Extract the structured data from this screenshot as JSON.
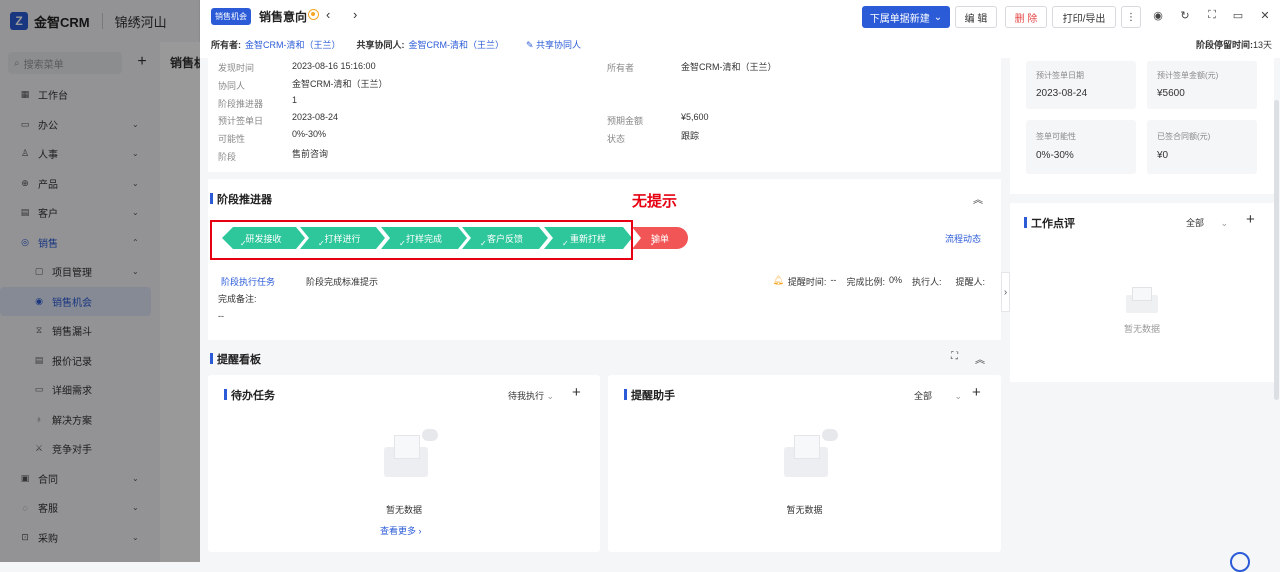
{
  "app": {
    "brand": "金智CRM",
    "org": "锦绣河山",
    "logo_letter": "Z"
  },
  "sidebar": {
    "search_placeholder": "搜索菜单",
    "items": [
      {
        "label": "工作台",
        "icon": "grid-icon"
      },
      {
        "label": "办公",
        "icon": "briefcase-icon",
        "chevron": "down"
      },
      {
        "label": "人事",
        "icon": "people-icon",
        "chevron": "down"
      },
      {
        "label": "产品",
        "icon": "box-icon",
        "chevron": "down"
      },
      {
        "label": "客户",
        "icon": "customer-icon",
        "chevron": "down"
      },
      {
        "label": "销售",
        "icon": "sales-icon",
        "chevron": "up"
      }
    ],
    "sub_items": [
      {
        "label": "项目管理",
        "icon": "project-icon",
        "chevron": "down"
      },
      {
        "label": "销售机会",
        "icon": "opportunity-icon"
      },
      {
        "label": "销售漏斗",
        "icon": "funnel-icon"
      },
      {
        "label": "报价记录",
        "icon": "quote-icon"
      },
      {
        "label": "详细需求",
        "icon": "requirement-icon"
      },
      {
        "label": "解决方案",
        "icon": "solution-icon"
      },
      {
        "label": "竞争对手",
        "icon": "competitor-icon"
      }
    ],
    "items_after": [
      {
        "label": "合同",
        "icon": "contract-icon",
        "chevron": "down"
      },
      {
        "label": "客服",
        "icon": "service-icon",
        "chevron": "down"
      },
      {
        "label": "采购",
        "icon": "purchase-icon",
        "chevron": "down"
      }
    ]
  },
  "background_page": {
    "title": "销售机"
  },
  "drawer": {
    "tag": "销售机会",
    "title": "销售意向",
    "buttons": {
      "new_sub": "下属单据新建",
      "edit": "编 辑",
      "delete": "删 除",
      "print": "打印/导出"
    },
    "owner_label": "所有者:",
    "owner_value": "金智CRM-清和（王兰）",
    "collab_label": "共享协同人:",
    "collab_value": "金智CRM-清和（王兰）",
    "share_link": "共享协同人",
    "stay_label": "阶段停留时间:",
    "stay_value": "13天"
  },
  "info": {
    "rows_left": [
      {
        "label": "发现时间",
        "value": "2023-08-16 15:16:00"
      },
      {
        "label": "协同人",
        "value": "金智CRM-清和（王兰）"
      },
      {
        "label": "阶段推进器",
        "value": "1"
      },
      {
        "label": "预计签单日",
        "value": "2023-08-24"
      },
      {
        "label": "可能性",
        "value": "0%-30%"
      },
      {
        "label": "阶段",
        "value": "售前咨询"
      }
    ],
    "rows_right": [
      {
        "label": "所有者",
        "value": "金智CRM-清和（王兰）"
      },
      {
        "label": "预期金额",
        "value": "¥5,600"
      },
      {
        "label": "状态",
        "value": "跟踪"
      }
    ]
  },
  "stage_advancer": {
    "title": "阶段推进器",
    "stages": [
      "研发接收",
      "打样进行",
      "打样完成",
      "客户反馈",
      "重新打样"
    ],
    "lost_stage": "输单",
    "flow_link": "流程动态",
    "annotation": "无提示",
    "task_tab": "阶段执行任务",
    "standard_tip": "阶段完成标准提示",
    "remind_time_label": "提醒时间:",
    "remind_time_value": "--",
    "ratio_label": "完成比例:",
    "ratio_value": "0%",
    "executor_label": "执行人:",
    "reminder_label": "提醒人:",
    "remark_label": "完成备注:",
    "remark_value": "--"
  },
  "reminder_board": {
    "title": "提醒看板",
    "todo": {
      "title": "待办任务",
      "filter": "待我执行",
      "empty": "暂无数据",
      "more": "查看更多"
    },
    "assistant": {
      "title": "提醒助手",
      "filter": "全部",
      "empty": "暂无数据"
    }
  },
  "right_panel": {
    "stats": [
      {
        "label": "预计签单日期",
        "value": "2023-08-24"
      },
      {
        "label": "预计签单金额(元)",
        "value": "¥5600"
      },
      {
        "label": "签单可能性",
        "value": "0%-30%"
      },
      {
        "label": "已签合同额(元)",
        "value": "¥0"
      }
    ],
    "review": {
      "title": "工作点评",
      "filter": "全部",
      "empty": "暂无数据"
    }
  },
  "colors": {
    "primary": "#2b5bd7",
    "stage_done": "#2ec79b",
    "stage_lost": "#f15555",
    "annotation": "#e60012"
  }
}
